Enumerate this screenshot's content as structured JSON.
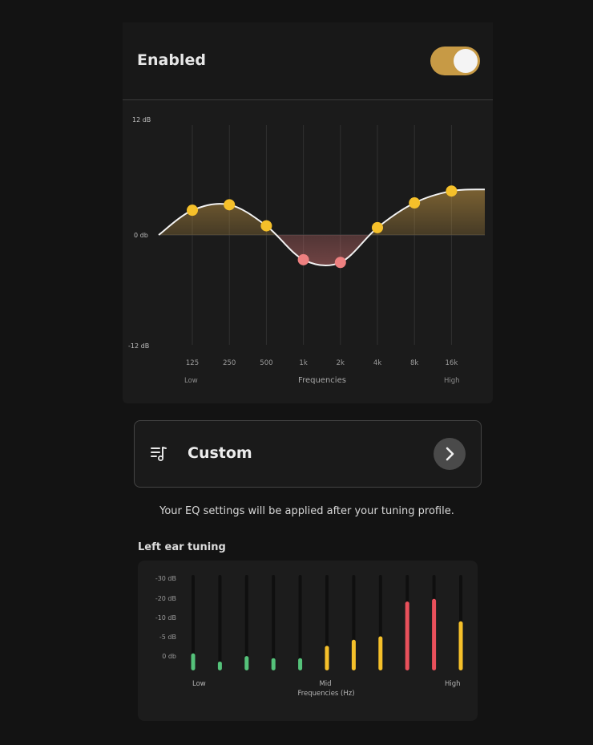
{
  "header": {
    "enabled_label": "Enabled",
    "toggle_on": true
  },
  "eq_chart": {
    "y_top_label": "12 dB",
    "y_mid_label": "0 db",
    "y_bottom_label": "-12 dB",
    "x_title": "Frequencies",
    "low_label": "Low",
    "high_label": "High"
  },
  "custom": {
    "label": "Custom",
    "icon": "music-list-icon",
    "action_icon": "chevron-right-icon"
  },
  "note": "Your EQ settings will be applied after your tuning profile.",
  "tuning": {
    "title": "Left ear tuning",
    "low_label": "Low",
    "mid_label": "Mid",
    "high_label": "High",
    "x_title": "Frequencies (Hz)"
  },
  "colors": {
    "accent": "#c79a45",
    "boost": "#f5c02a",
    "cut": "#ee8080",
    "good": "#55c27a",
    "alert": "#e9505b"
  },
  "chart_data": [
    {
      "type": "line",
      "categories": [
        "125",
        "250",
        "500",
        "1k",
        "2k",
        "4k",
        "8k",
        "16k"
      ],
      "values": [
        2.7,
        3.3,
        1.0,
        -2.7,
        -3.0,
        0.8,
        3.5,
        4.8
      ],
      "ylim": [
        -12,
        12
      ],
      "xlabel": "Frequencies"
    },
    {
      "type": "bar",
      "y_ticks": [
        "-30 dB",
        "-20 dB",
        "-10 dB",
        "-5 dB",
        "0 db"
      ],
      "values": [
        2.5,
        1.3,
        2.1,
        1.8,
        1.8,
        3.6,
        4.5,
        5.0,
        10.1,
        10.5,
        7.2
      ],
      "ylim": [
        0,
        14
      ],
      "xlabel": "Frequencies (Hz)"
    }
  ]
}
